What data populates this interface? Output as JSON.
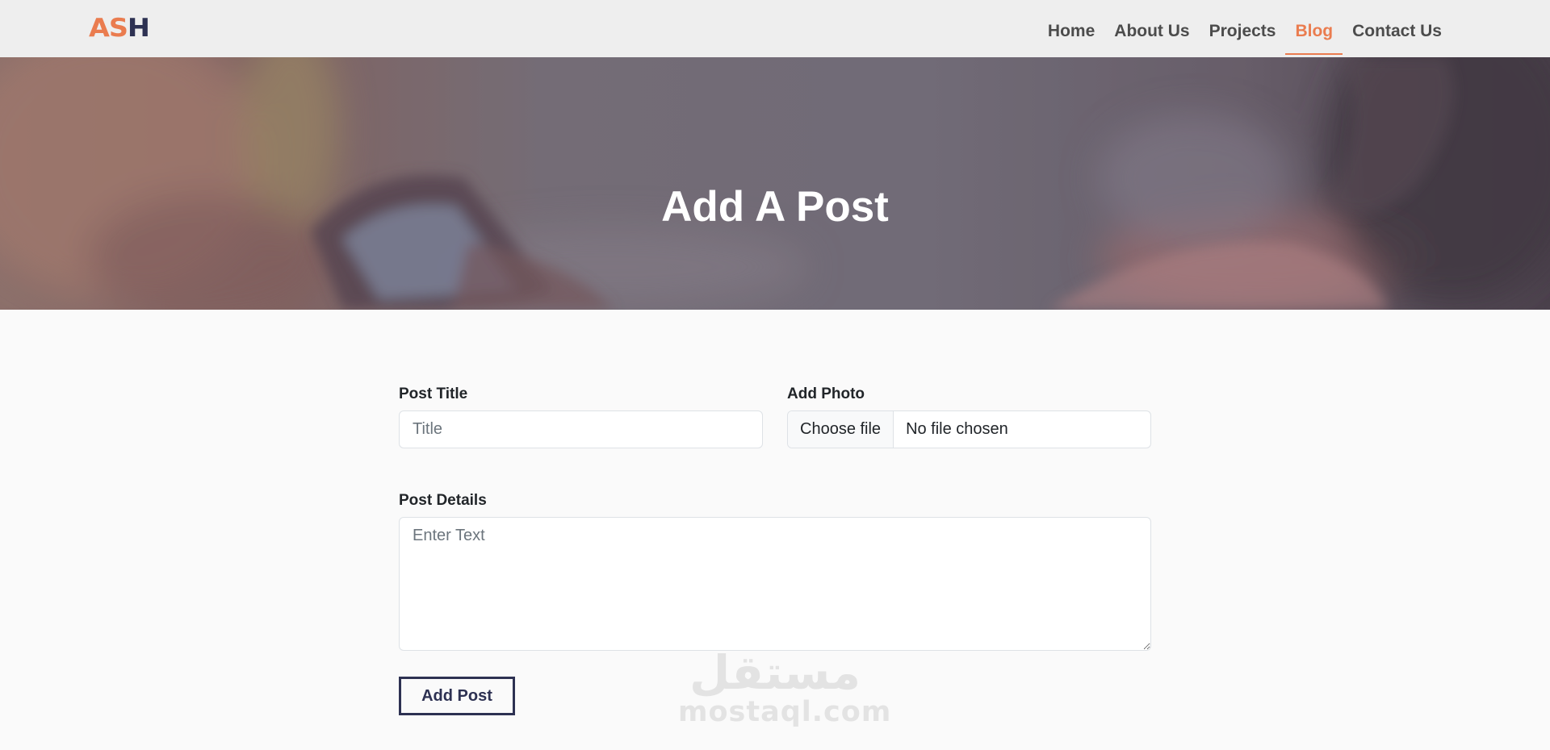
{
  "logo": {
    "part_a": "AS",
    "part_b": "H"
  },
  "nav": {
    "items": [
      {
        "label": "Home"
      },
      {
        "label": "About Us"
      },
      {
        "label": "Projects"
      },
      {
        "label": "Blog",
        "active": true
      },
      {
        "label": "Contact Us"
      }
    ]
  },
  "hero": {
    "title": "Add A Post"
  },
  "form": {
    "title_label": "Post Title",
    "title_placeholder": "Title",
    "title_value": "",
    "photo_label": "Add Photo",
    "photo_button": "Choose file",
    "photo_status": "No file chosen",
    "details_label": "Post Details",
    "details_placeholder": "Enter Text",
    "details_value": "",
    "submit_label": "Add Post"
  },
  "watermark": {
    "arabic": "مستقل",
    "latin": "mostaql.com"
  },
  "colors": {
    "accent": "#ea7c4f",
    "navy": "#2d3152",
    "nav_bg": "#eeeeee",
    "page_bg": "#fafafa"
  }
}
